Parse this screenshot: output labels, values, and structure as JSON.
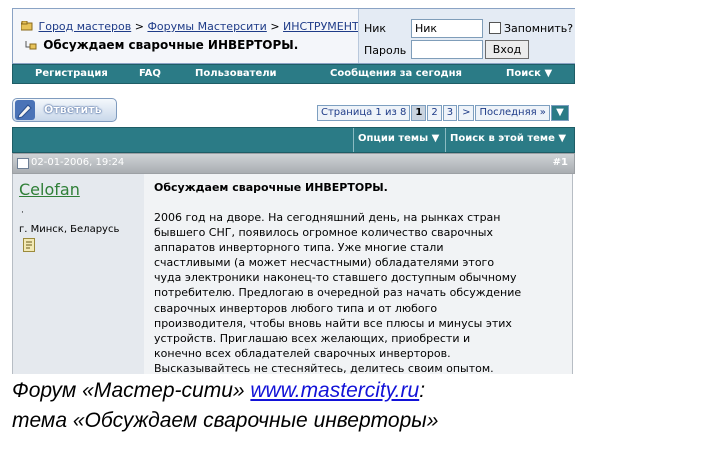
{
  "breadcrumb": {
    "items": [
      "Город мастеров",
      "Форумы Мастерсити",
      "ИНСТРУМЕНТЫ"
    ],
    "separator": ">",
    "thread_title": "Обсуждаем сварочные ИНВЕРТОРЫ."
  },
  "login": {
    "nick_label": "Ник",
    "nick_value": "Ник",
    "remember_label": "Запомнить?",
    "password_label": "Пароль",
    "submit_label": "Вход"
  },
  "navbar": [
    "Регистрация",
    "FAQ",
    "Пользователи",
    "Сообщения за сегодня",
    "Поиск"
  ],
  "reply_button": "Ответить",
  "pagination": {
    "info": "Страница 1 из 8",
    "pages": [
      "1",
      "2",
      "3",
      ">"
    ],
    "last": "Последняя »"
  },
  "thread_tools": {
    "options": "Опции темы",
    "search": "Поиск в этой теме"
  },
  "post": {
    "date": "02-01-2006, 19:24",
    "number": "#1",
    "username": "Celofan",
    "dot": "·",
    "location": "г. Минск, Беларусь",
    "title": "Обсуждаем сварочные ИНВЕРТОРЫ.",
    "text": "2006 год на дворе. На сегодняшний день, на рынках стран\nбывшего СНГ, появилось огромное количество сварочных\nаппаратов инверторного типа. Уже многие стали\nсчастливыми (а может несчастными) обладателями этого\nчуда электроники наконец-то ставшего доступным обычному\nпотребителю. Предлогаю в очередной раз начать обсуждение\nсварочных инверторов любого типа и от любого\nпроизводителя, чтобы вновь найти все плюсы и минусы этих\nустройств. Приглашаю всех желающих, приобрести и\nконечно всех обладателей сварочных инверторов.\nВысказывайтесь не стесняйтесь, делитесь своим опытом."
  },
  "caption": {
    "line1_before": "Форум «Мастер-сити» ",
    "url": "www.mastercity.ru",
    "line1_after": ":",
    "line2": "тема «Обсуждаем сварочные инверторы»"
  },
  "colors": {
    "navbar": "#2b7b86",
    "link": "#1f3c88",
    "username": "#2f7f37",
    "caption_url": "#1212d8"
  }
}
